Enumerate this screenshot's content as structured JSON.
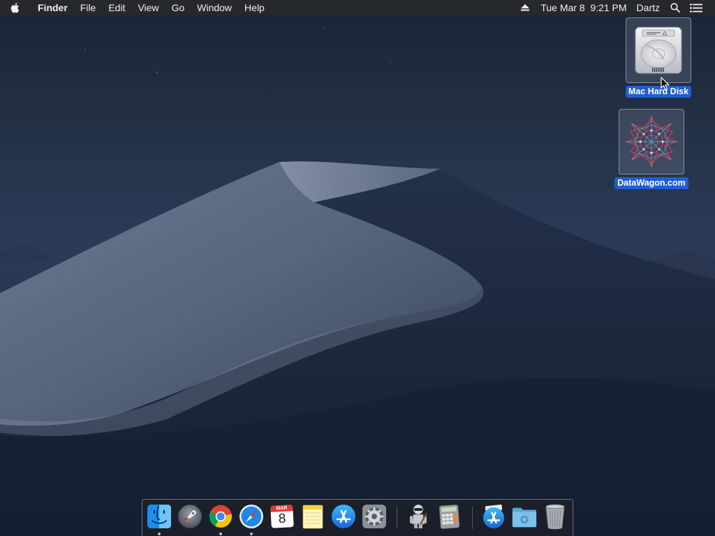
{
  "menubar": {
    "app_name": "Finder",
    "menus": [
      "File",
      "Edit",
      "View",
      "Go",
      "Window",
      "Help"
    ],
    "clock": "Tue Mar 8  9:21 PM",
    "user": "Dartz",
    "status_icons": [
      "eject-icon",
      "spotlight-search-icon",
      "notification-center-icon"
    ]
  },
  "desktop_icons": [
    {
      "label": "Mac Hard Disk",
      "icon": "hard-disk-icon",
      "selected": true
    },
    {
      "label": "DataWagon.com",
      "icon": "network-volume-icon",
      "selected": true
    }
  ],
  "dock": {
    "items": [
      {
        "name": "Finder",
        "icon": "finder-icon",
        "running": true
      },
      {
        "name": "Launchpad",
        "icon": "launchpad-icon",
        "running": false
      },
      {
        "name": "Google Chrome",
        "icon": "chrome-icon",
        "running": true
      },
      {
        "name": "Safari",
        "icon": "safari-icon",
        "running": true
      },
      {
        "name": "Calendar",
        "icon": "calendar-icon",
        "running": false,
        "month": "MAR",
        "day": "8"
      },
      {
        "name": "Notes",
        "icon": "notes-icon",
        "running": false
      },
      {
        "name": "App Store",
        "icon": "app-store-icon",
        "running": false
      },
      {
        "name": "System Preferences",
        "icon": "system-preferences-icon",
        "running": false
      },
      {
        "name": "Automator",
        "icon": "automator-icon",
        "running": false
      },
      {
        "name": "Calculator",
        "icon": "calculator-icon",
        "running": false
      },
      {
        "name": "Applications",
        "icon": "applications-stack-icon",
        "running": false
      },
      {
        "name": "Downloads",
        "icon": "downloads-folder-icon",
        "running": false
      },
      {
        "name": "Trash",
        "icon": "trash-icon",
        "running": false
      }
    ]
  },
  "colors": {
    "selection_blue": "#1f5fd1",
    "menubar_bg": "#28282c",
    "wallpaper_sky": "#23324b"
  }
}
